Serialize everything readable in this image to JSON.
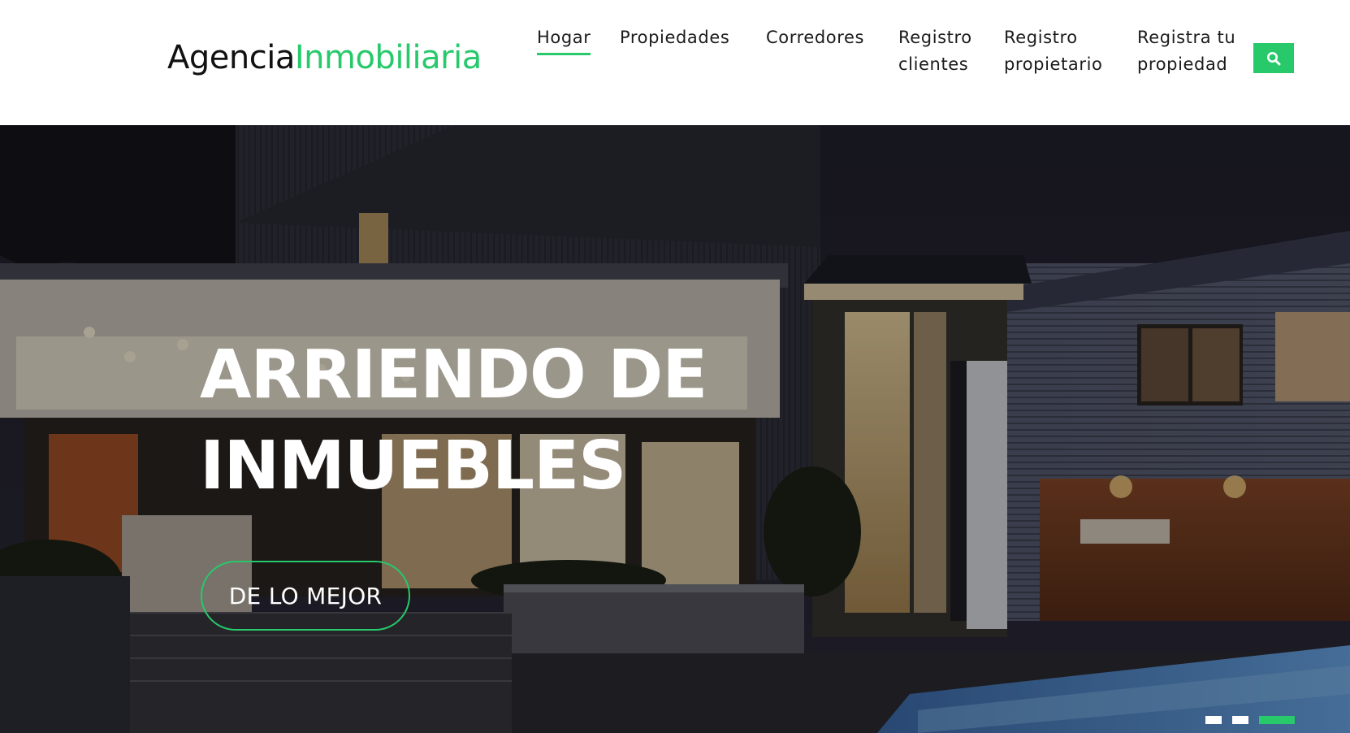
{
  "logo": {
    "part1": "Agencia",
    "part2": "Inmobiliaria",
    "accent_color": "#27c96b"
  },
  "nav": {
    "items": [
      {
        "line1": "Hogar",
        "line2": "",
        "active": true
      },
      {
        "line1": "Propiedades",
        "line2": ""
      },
      {
        "line1": "Corredores",
        "line2": ""
      },
      {
        "line1": "Registro",
        "line2": "clientes"
      },
      {
        "line1": "Registro",
        "line2": "propietario"
      },
      {
        "line1": "Registra tu",
        "line2": "propiedad"
      }
    ],
    "search_icon": "search-icon"
  },
  "hero": {
    "title_line1": "ARRIENDO DE",
    "title_line2": "INMUEBLES",
    "cta_label": "DE LO MEJOR",
    "background": "night-house-photo",
    "slides": {
      "total": 3,
      "active": 3
    }
  },
  "colors": {
    "accent": "#27c96b",
    "text_dark": "#1b1b1b",
    "hero_text": "#ffffff"
  }
}
